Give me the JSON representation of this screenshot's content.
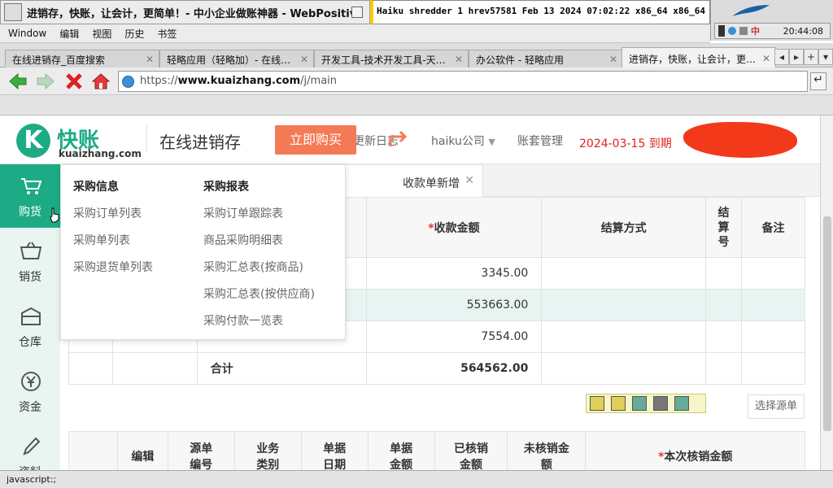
{
  "window": {
    "title": "进销存，快账，让会计，更简单！- 中小企业做账神器 - WebPositive",
    "terminal_title": "Haiku shredder 1 hrev57581 Feb 13 2024 07:02:22 x86_64 x86_64 Haiku",
    "clock": "20:44:08",
    "ime": "中"
  },
  "menu": [
    "Window",
    "编辑",
    "视图",
    "历史",
    "书签"
  ],
  "browser_tabs": [
    {
      "label": "在线进销存_百度搜索"
    },
    {
      "label": "轻略应用（轻略加）- 在线…"
    },
    {
      "label": "开发工具-技术开发工具-天…"
    },
    {
      "label": "办公软件 - 轻略应用"
    },
    {
      "label": "进销存，快账，让会计，更…"
    }
  ],
  "url": {
    "prefix": "https://",
    "domain": "www.kuaizhang.com",
    "path": "/j/main"
  },
  "status_text": "javascript:;",
  "header": {
    "logo_mark": "K",
    "logo_cn": "快账",
    "logo_en": "kuaizhang.com",
    "app_name": "在线进销存",
    "buy_label": "立即购买",
    "changelog": "更新日志",
    "company": "haiku公司",
    "account_mgmt": "账套管理",
    "expire": "2024-03-15 到期"
  },
  "sidebar": [
    {
      "label": "购货",
      "icon": "cart-icon"
    },
    {
      "label": "销货",
      "icon": "basket-icon"
    },
    {
      "label": "仓库",
      "icon": "warehouse-icon"
    },
    {
      "label": "资金",
      "icon": "yen-icon"
    },
    {
      "label": "资料",
      "icon": "pencil-icon"
    }
  ],
  "page_tab": "收款单新增",
  "table1": {
    "headers": {
      "amount": "收款金额",
      "method": "结算方式",
      "settle_no": "结算号",
      "remark": "备注"
    },
    "rows": [
      {
        "amount": "3345.00"
      },
      {
        "amount": "553663.00"
      },
      {
        "amount": "7554.00"
      }
    ],
    "total_label": "合计",
    "total": "564562.00"
  },
  "select_source": "选择源单",
  "table2": {
    "headers": [
      "编辑",
      "源单编号",
      "业务类别",
      "单据日期",
      "单据金额",
      "已核销金额",
      "未核销金额",
      "本次核销金额"
    ]
  },
  "dropdown": {
    "col1": {
      "title": "采购信息",
      "items": [
        "采购订单列表",
        "采购单列表",
        "采购退货单列表"
      ]
    },
    "col2": {
      "title": "采购报表",
      "items": [
        "采购订单跟踪表",
        "商品采购明细表",
        "采购汇总表(按商品)",
        "采购汇总表(按供应商)",
        "采购付款一览表"
      ]
    }
  },
  "colors": {
    "brand": "#1dab86",
    "buy": "#f47a55",
    "expire": "#dd2222"
  }
}
